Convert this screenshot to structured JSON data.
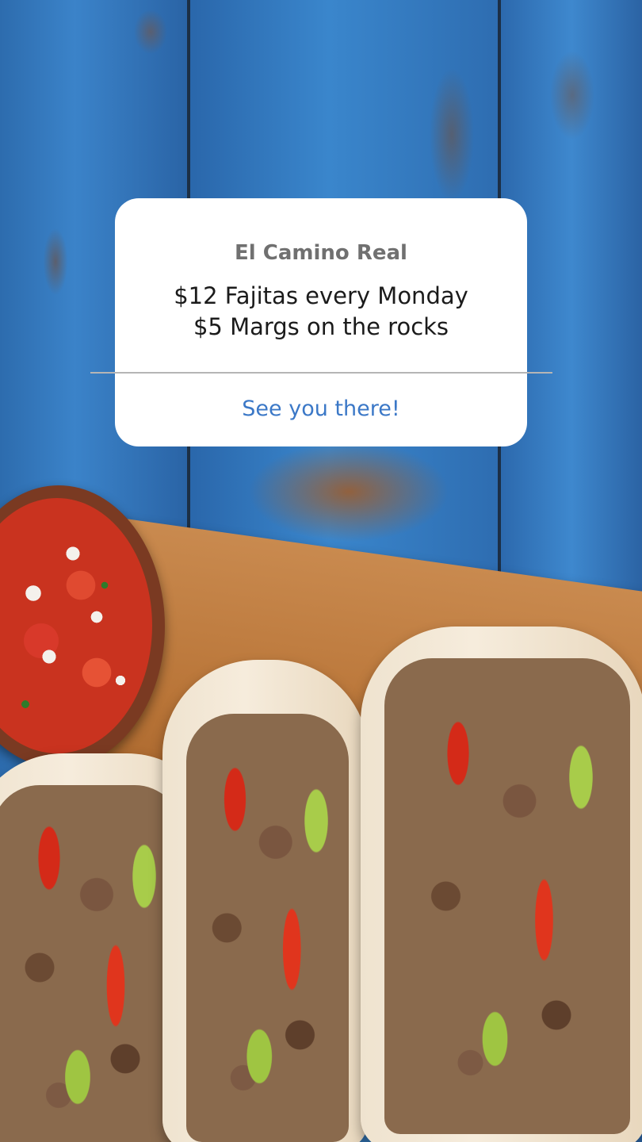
{
  "story": {
    "title": "El Camino Real",
    "message": "$12 Fajitas every Monday\n$5 Margs on the rocks",
    "action_label": "See you there!",
    "action_color": "#3b78c7"
  },
  "background": {
    "description_icon": "photo-tacos-salsa"
  }
}
